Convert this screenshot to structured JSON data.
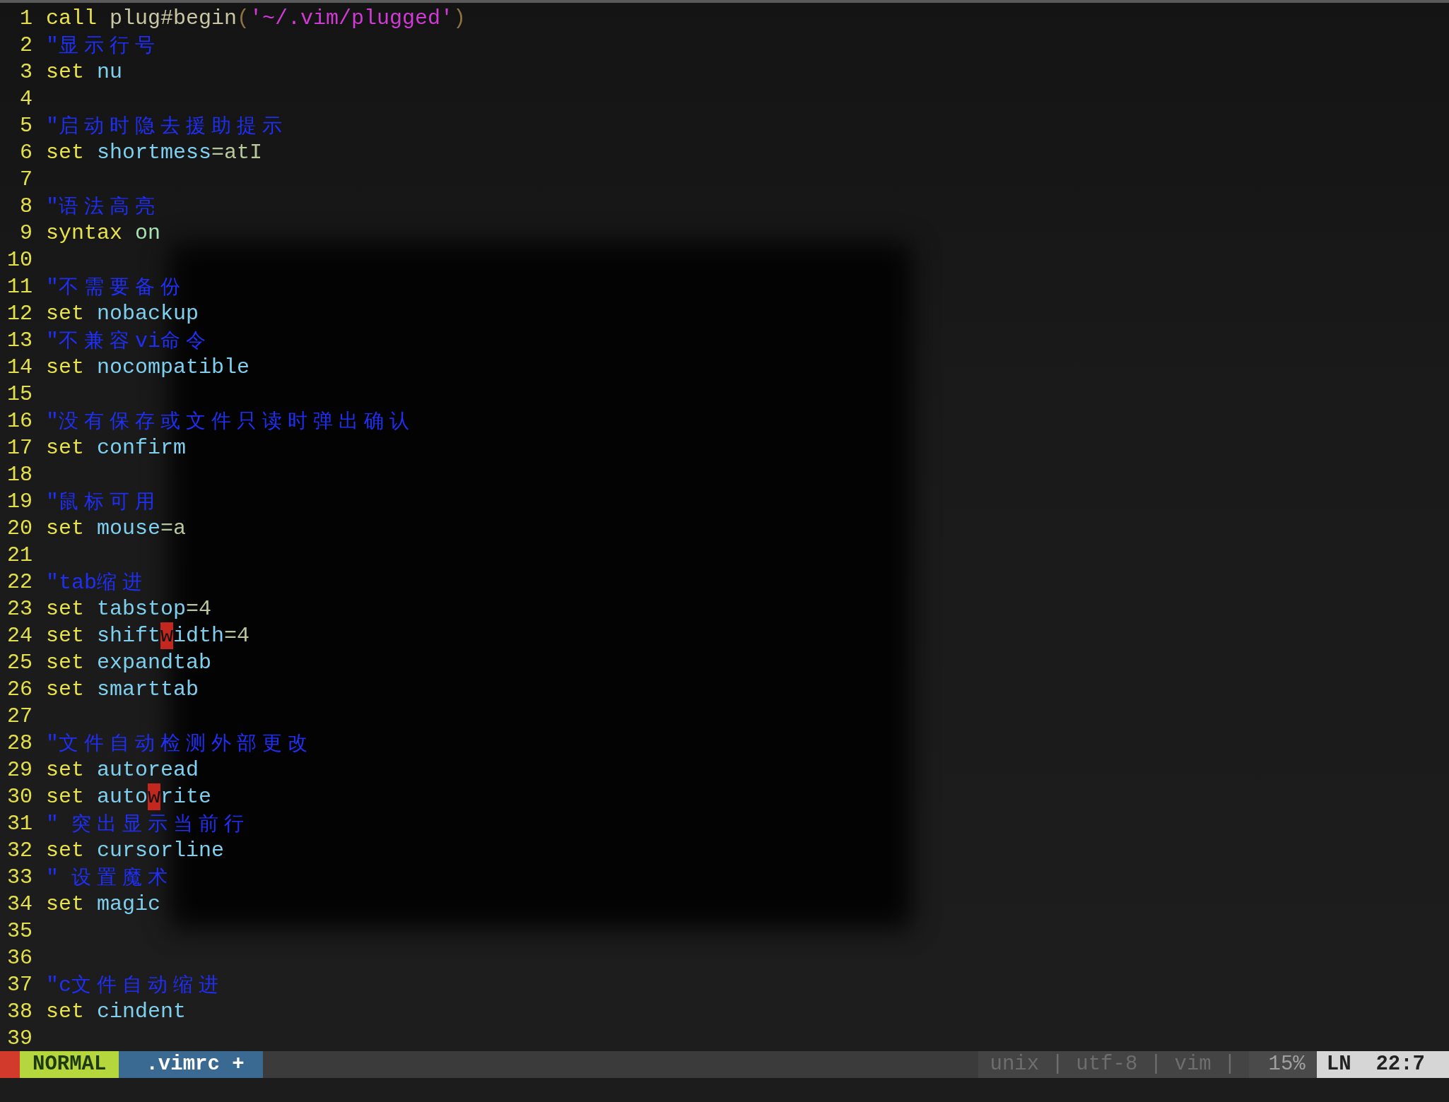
{
  "editor": {
    "lines": [
      {
        "number": "1",
        "segments": [
          {
            "text": "call ",
            "kind": "keyword"
          },
          {
            "text": "plug#begin",
            "kind": "function"
          },
          {
            "text": "(",
            "kind": "paren"
          },
          {
            "text": "'~/.vim/plugged'",
            "kind": "string"
          },
          {
            "text": ")",
            "kind": "paren"
          }
        ]
      },
      {
        "number": "2",
        "segments": [
          {
            "text": "\"显示行号",
            "kind": "comment"
          }
        ]
      },
      {
        "number": "3",
        "segments": [
          {
            "text": "set ",
            "kind": "keyword"
          },
          {
            "text": "nu",
            "kind": "option"
          }
        ]
      },
      {
        "number": "4"
      },
      {
        "number": "5",
        "segments": [
          {
            "text": "\"启动时隐去援助提示",
            "kind": "comment"
          }
        ]
      },
      {
        "number": "6",
        "segments": [
          {
            "text": "set ",
            "kind": "keyword"
          },
          {
            "text": "shortmess",
            "kind": "option"
          },
          {
            "text": "=",
            "kind": "operator"
          },
          {
            "text": "atI",
            "kind": "value"
          }
        ]
      },
      {
        "number": "7"
      },
      {
        "number": "8",
        "segments": [
          {
            "text": "\"语法高亮",
            "kind": "comment"
          }
        ]
      },
      {
        "number": "9",
        "segments": [
          {
            "text": "syntax ",
            "kind": "keyword"
          },
          {
            "text": "on",
            "kind": "constant"
          }
        ]
      },
      {
        "number": "10"
      },
      {
        "number": "11",
        "segments": [
          {
            "text": "\"不需要备份",
            "kind": "comment"
          }
        ]
      },
      {
        "number": "12",
        "segments": [
          {
            "text": "set ",
            "kind": "keyword"
          },
          {
            "text": "nobackup",
            "kind": "option"
          }
        ]
      },
      {
        "number": "13",
        "segments": [
          {
            "text": "\"不兼容vi命令",
            "kind": "comment"
          }
        ]
      },
      {
        "number": "14",
        "segments": [
          {
            "text": "set ",
            "kind": "keyword"
          },
          {
            "text": "nocompatible",
            "kind": "option"
          }
        ]
      },
      {
        "number": "15"
      },
      {
        "number": "16",
        "segments": [
          {
            "text": "\"没有保存或文件只读时弹出确认",
            "kind": "comment"
          }
        ]
      },
      {
        "number": "17",
        "segments": [
          {
            "text": "set ",
            "kind": "keyword"
          },
          {
            "text": "confirm",
            "kind": "option"
          }
        ]
      },
      {
        "number": "18"
      },
      {
        "number": "19",
        "segments": [
          {
            "text": "\"鼠标可用",
            "kind": "comment"
          }
        ]
      },
      {
        "number": "20",
        "segments": [
          {
            "text": "set ",
            "kind": "keyword"
          },
          {
            "text": "mouse",
            "kind": "option"
          },
          {
            "text": "=",
            "kind": "operator"
          },
          {
            "text": "a",
            "kind": "value"
          }
        ]
      },
      {
        "number": "21"
      },
      {
        "number": "22",
        "segments": [
          {
            "text": "\"tab缩进",
            "kind": "comment"
          }
        ]
      },
      {
        "number": "23",
        "segments": [
          {
            "text": "set ",
            "kind": "keyword"
          },
          {
            "text": "tabstop",
            "kind": "option"
          },
          {
            "text": "=",
            "kind": "operator"
          },
          {
            "text": "4",
            "kind": "value"
          }
        ]
      },
      {
        "number": "24",
        "segments": [
          {
            "text": "set ",
            "kind": "keyword"
          },
          {
            "text": "shift",
            "kind": "option"
          },
          {
            "text": "w",
            "kind": "match"
          },
          {
            "text": "idth",
            "kind": "option"
          },
          {
            "text": "=",
            "kind": "operator"
          },
          {
            "text": "4",
            "kind": "value"
          }
        ]
      },
      {
        "number": "25",
        "segments": [
          {
            "text": "set ",
            "kind": "keyword"
          },
          {
            "text": "expandtab",
            "kind": "option"
          }
        ]
      },
      {
        "number": "26",
        "segments": [
          {
            "text": "set ",
            "kind": "keyword"
          },
          {
            "text": "smarttab",
            "kind": "option"
          }
        ]
      },
      {
        "number": "27"
      },
      {
        "number": "28",
        "segments": [
          {
            "text": "\"文件自动检测外部更改",
            "kind": "comment"
          }
        ]
      },
      {
        "number": "29",
        "segments": [
          {
            "text": "set ",
            "kind": "keyword"
          },
          {
            "text": "autoread",
            "kind": "option"
          }
        ]
      },
      {
        "number": "30",
        "segments": [
          {
            "text": "set ",
            "kind": "keyword"
          },
          {
            "text": "auto",
            "kind": "option"
          },
          {
            "text": "w",
            "kind": "match"
          },
          {
            "text": "rite",
            "kind": "option"
          }
        ]
      },
      {
        "number": "31",
        "segments": [
          {
            "text": "\" 突出显示当前行",
            "kind": "comment"
          }
        ]
      },
      {
        "number": "32",
        "segments": [
          {
            "text": "set ",
            "kind": "keyword"
          },
          {
            "text": "cursorline",
            "kind": "option"
          }
        ]
      },
      {
        "number": "33",
        "segments": [
          {
            "text": "\" 设置魔术",
            "kind": "comment"
          }
        ]
      },
      {
        "number": "34",
        "segments": [
          {
            "text": "set ",
            "kind": "keyword"
          },
          {
            "text": "magic",
            "kind": "option"
          }
        ]
      },
      {
        "number": "35"
      },
      {
        "number": "36"
      },
      {
        "number": "37",
        "segments": [
          {
            "text": "\"c文件自动缩进",
            "kind": "comment"
          }
        ]
      },
      {
        "number": "38",
        "segments": [
          {
            "text": "set ",
            "kind": "keyword"
          },
          {
            "text": "cindent",
            "kind": "option"
          }
        ]
      },
      {
        "number": "39"
      }
    ]
  },
  "status_bar": {
    "mode": "NORMAL",
    "file": ".vimrc +",
    "file_info": "unix | utf-8 | vim |",
    "percent": "15%",
    "position": "LN  22:7"
  }
}
